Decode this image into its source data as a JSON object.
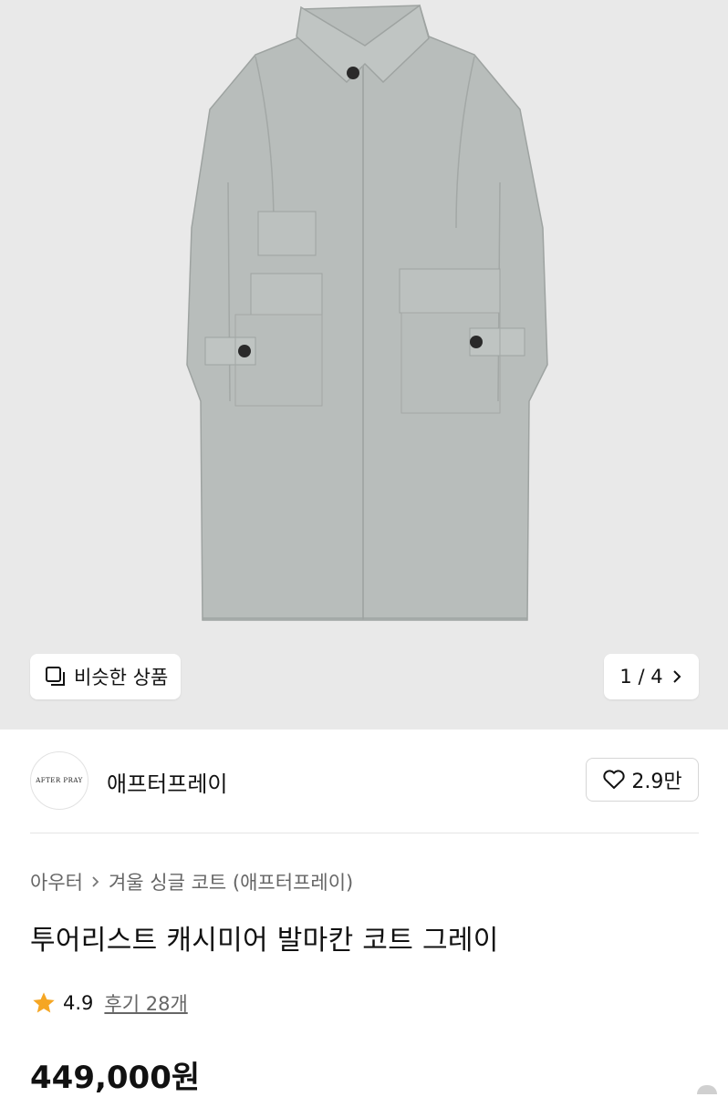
{
  "gallery": {
    "similar_label": "비슷한 상품",
    "pager": "1 / 4",
    "image_icon": "garment-image-icon",
    "coat_color": "#b7bcba"
  },
  "brand": {
    "logo_text": "AFTER PRAY",
    "name": "애프터프레이",
    "likes": "2.9만"
  },
  "breadcrumb": {
    "root": "아우터",
    "category": "겨울 싱글 코트 (애프터프레이)"
  },
  "product": {
    "title": "투어리스트 캐시미어 발마칸 코트 그레이",
    "rating": "4.9",
    "reviews": "후기 28개",
    "price": "449,000원"
  },
  "colors": {
    "star": "#f5a623",
    "hero_bg": "#e9e9e9"
  }
}
